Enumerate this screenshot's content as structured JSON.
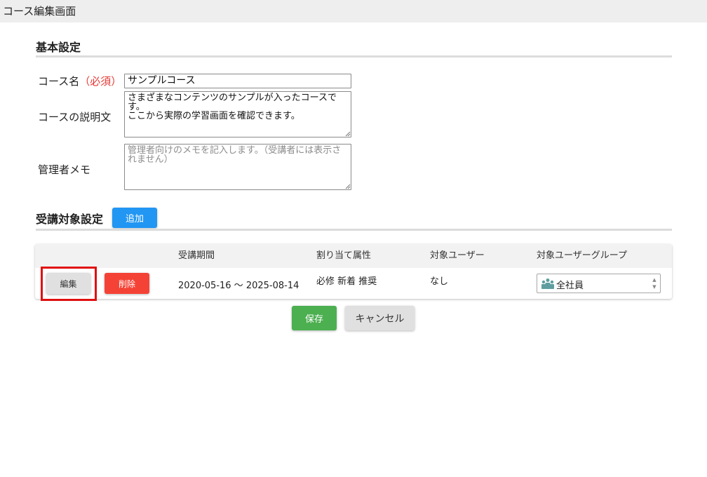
{
  "window": {
    "title": "コース編集画面"
  },
  "basic_settings": {
    "title": "基本設定",
    "course_name": {
      "label": "コース名",
      "required": "（必須）",
      "value": "サンプルコース"
    },
    "description": {
      "label": "コースの説明文",
      "value": "さまざまなコンテンツのサンプルが入ったコースです。\nここから実際の学習画面を確認できます。"
    },
    "admin_memo": {
      "label": "管理者メモ",
      "value": "",
      "placeholder": "管理者向けのメモを記入します。（受講者には表示されません）"
    }
  },
  "enrollment": {
    "title": "受講対象設定",
    "add_label": "追加",
    "columns": [
      "",
      "",
      "受講期間",
      "割り当て属性",
      "対象ユーザー",
      "対象ユーザーグループ"
    ],
    "rows": [
      {
        "edit_label": "編集",
        "delete_label": "削除",
        "period": "2020-05-16 ～ 2025-08-14",
        "attributes": "必修 新着 推奨",
        "target_users": "なし",
        "target_group": "全社員",
        "group_icon": "users-group-icon"
      }
    ]
  },
  "footer": {
    "save_label": "保存",
    "cancel_label": "キャンセル"
  },
  "colors": {
    "blue": "#2196f3",
    "red": "#f44336",
    "green": "#4caf50",
    "grey": "#e0e0e0",
    "required": "#e53935",
    "highlight": "#e01010",
    "icon_teal": "#5f9ea0"
  }
}
